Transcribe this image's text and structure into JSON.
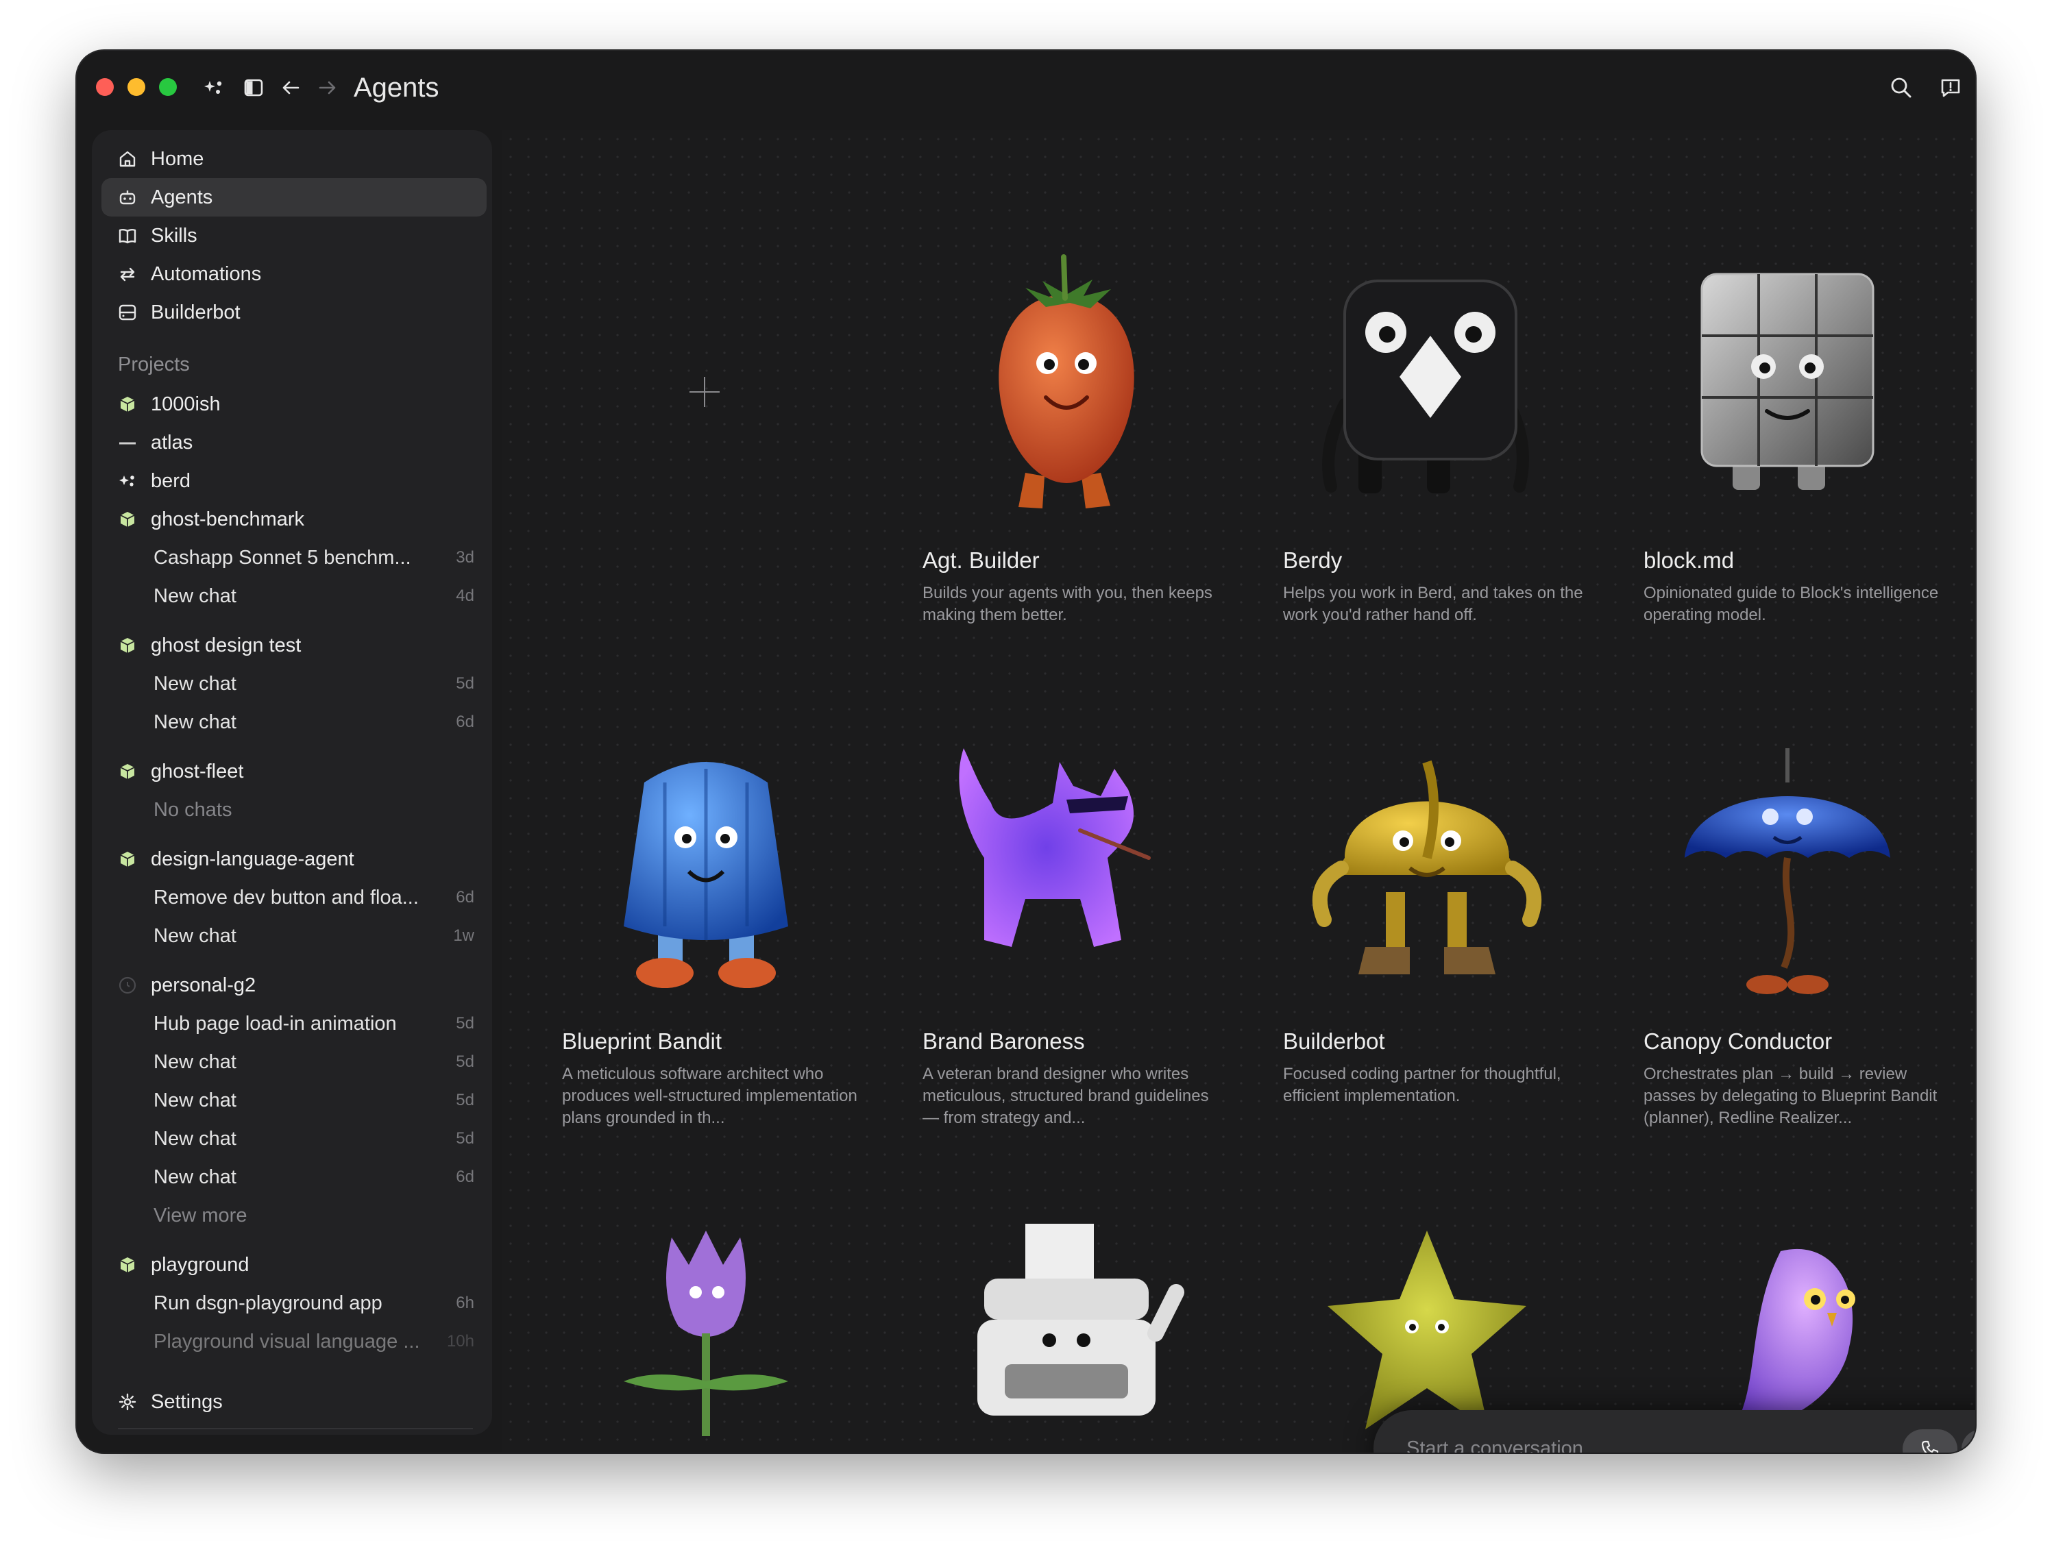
{
  "window": {
    "title": "Agents"
  },
  "nav": [
    {
      "label": "Home",
      "icon": "home-icon"
    },
    {
      "label": "Agents",
      "icon": "agents-icon",
      "active": true
    },
    {
      "label": "Skills",
      "icon": "book-icon"
    },
    {
      "label": "Automations",
      "icon": "repeat-icon"
    },
    {
      "label": "Builderbot",
      "icon": "builderbot-icon"
    }
  ],
  "projects_heading": "Projects",
  "projects": [
    {
      "label": "1000ish",
      "icon": "cube-icon"
    },
    {
      "label": "atlas",
      "icon": "dash-icon"
    },
    {
      "label": "berd",
      "icon": "berd-icon"
    },
    {
      "label": "ghost-benchmark",
      "icon": "cube-icon",
      "chats": [
        {
          "label": "Cashapp Sonnet 5 benchm...",
          "time": "3d"
        },
        {
          "label": "New chat",
          "time": "4d"
        }
      ]
    },
    {
      "label": "ghost design test",
      "icon": "cube-icon",
      "chats": [
        {
          "label": "New chat",
          "time": "5d"
        },
        {
          "label": "New chat",
          "time": "6d"
        }
      ]
    },
    {
      "label": "ghost-fleet",
      "icon": "cube-icon",
      "empty": "No chats"
    },
    {
      "label": "design-language-agent",
      "icon": "cube-icon",
      "chats": [
        {
          "label": "Remove dev button and floa...",
          "time": "6d"
        },
        {
          "label": "New chat",
          "time": "1w"
        }
      ]
    },
    {
      "label": "personal-g2",
      "icon": "circle-icon",
      "chats": [
        {
          "label": "Hub page load-in animation",
          "time": "5d"
        },
        {
          "label": "New chat",
          "time": "5d"
        },
        {
          "label": "New chat",
          "time": "5d"
        },
        {
          "label": "New chat",
          "time": "5d"
        },
        {
          "label": "New chat",
          "time": "6d"
        }
      ],
      "more": "View more"
    },
    {
      "label": "playground",
      "icon": "cube-icon",
      "chats": [
        {
          "label": "Run dsgn-playground app",
          "time": "6h"
        },
        {
          "label": "Playground visual language ...",
          "time": "10h"
        }
      ]
    }
  ],
  "settings_label": "Settings",
  "agents": [
    {
      "name": "Agt. Builder",
      "description": "Builds your agents with you, then keeps making them better.",
      "art": "strawberry"
    },
    {
      "name": "Berdy",
      "description": "Helps you work in Berd, and takes on the work you'd rather hand off.",
      "art": "black-cube"
    },
    {
      "name": "block.md",
      "description": "Opinionated guide to Block's intelligence operating model.",
      "art": "chrome-cube"
    },
    {
      "name": "Blueprint Bandit",
      "description": "A meticulous software architect who produces well-structured implementation plans grounded in th...",
      "art": "blue-jelly"
    },
    {
      "name": "Brand Baroness",
      "description": "A veteran brand designer who writes meticulous, structured brand guidelines — from strategy and...",
      "art": "purple-cat"
    },
    {
      "name": "Builderbot",
      "description": "Focused coding partner for thoughtful, efficient implementation.",
      "art": "hard-hat"
    },
    {
      "name": "Canopy Conductor",
      "description": "Orchestrates plan → build → review passes by delegating to Blueprint Bandit (planner), Redline Realizer...",
      "art": "umbrella"
    },
    {
      "name": "",
      "description": "",
      "art": "tulip"
    },
    {
      "name": "",
      "description": "",
      "art": "typewriter"
    },
    {
      "name": "",
      "description": "",
      "art": "star"
    },
    {
      "name": "",
      "description": "",
      "art": "owl"
    }
  ],
  "composer": {
    "placeholder": "Start a conversation"
  },
  "colors": {
    "window_bg": "#1a1a1b",
    "sidebar_bg": "#222224",
    "active_bg": "#363638",
    "project_icon": "#c8e6a0"
  }
}
